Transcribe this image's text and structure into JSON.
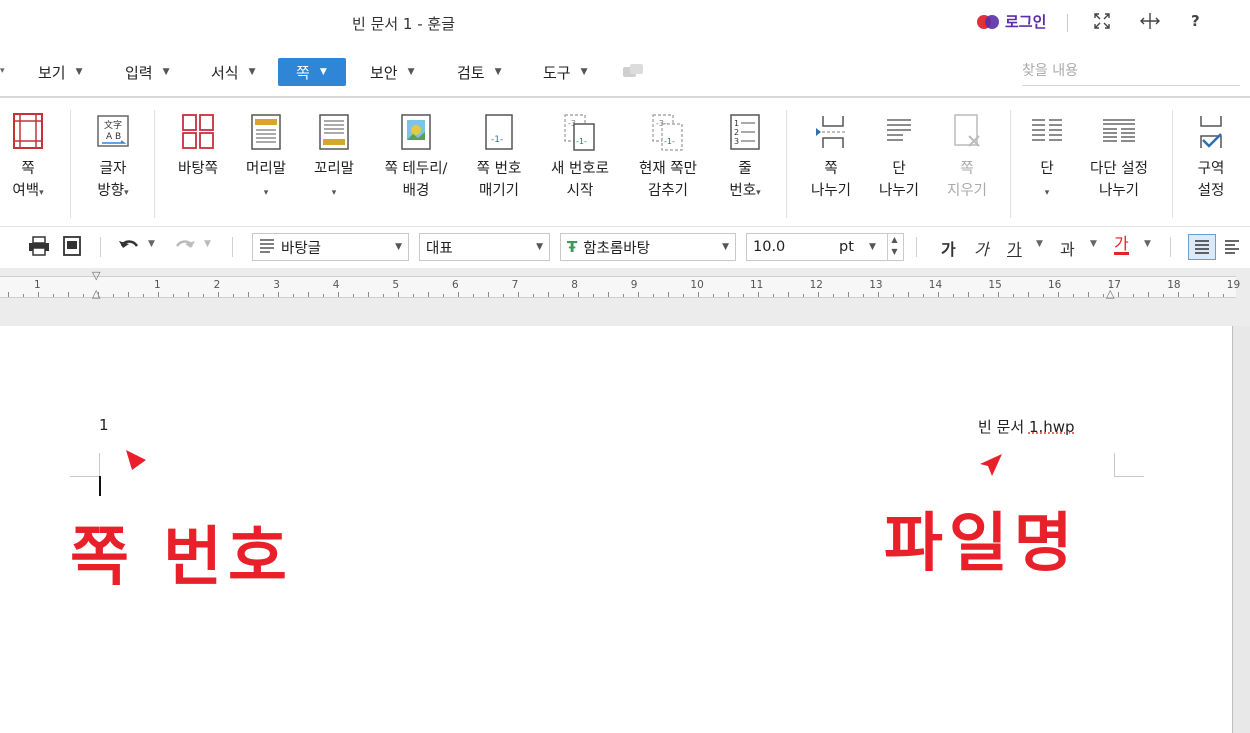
{
  "window": {
    "title": "빈 문서 1 - 훈글",
    "login_label": "로그인",
    "icons": [
      "fullscreen-icon",
      "resize-icon",
      "help-icon"
    ],
    "help_glyph": "?"
  },
  "menu": {
    "items": [
      {
        "label": "보기"
      },
      {
        "label": "입력"
      },
      {
        "label": "서식"
      },
      {
        "label": "쪽",
        "active": true
      },
      {
        "label": "보안"
      },
      {
        "label": "검토"
      },
      {
        "label": "도구"
      }
    ],
    "search_placeholder": "찾을 내용"
  },
  "ribbon": {
    "page_margin": {
      "line1": "쪽",
      "line2": "여백"
    },
    "text_direction": {
      "line1": "글자",
      "line2": "방향"
    },
    "background_page": {
      "line1": "바탕쪽"
    },
    "header": {
      "line1": "머리말"
    },
    "footer": {
      "line1": "꼬리말"
    },
    "page_border": {
      "line1": "쪽 테두리/",
      "line2": "배경"
    },
    "page_number": {
      "line1": "쪽 번호",
      "line2": "매기기"
    },
    "new_number": {
      "line1": "새 번호로",
      "line2": "시작"
    },
    "hide_current": {
      "line1": "현재 쪽만",
      "line2": "감추기"
    },
    "line_number": {
      "line1": "줄",
      "line2": "번호"
    },
    "page_break": {
      "line1": "쪽",
      "line2": "나누기"
    },
    "column_break": {
      "line1": "단",
      "line2": "나누기"
    },
    "delete_page": {
      "line1": "쪽",
      "line2": "지우기"
    },
    "columns": {
      "line1": "단"
    },
    "multi_column": {
      "line1": "다단 설정",
      "line2": "나누기"
    },
    "section": {
      "line1": "구역",
      "line2": "설정"
    }
  },
  "format_bar": {
    "style": "바탕글",
    "style_lang": "대표",
    "font": "함초롬바탕",
    "size": "10.0",
    "unit": "pt",
    "bold_glyph": "가",
    "italic_glyph": "가",
    "underline_glyph": "가",
    "strike_glyph": "과",
    "color_glyph": "가",
    "accent_color": "#2f86d6",
    "text_color": "#e8202a"
  },
  "ruler": {
    "labels": [
      "1",
      "1",
      "2",
      "3",
      "4",
      "5",
      "6",
      "7",
      "8",
      "9",
      "10",
      "11",
      "12",
      "13",
      "14",
      "15",
      "16",
      "17",
      "18",
      "19"
    ]
  },
  "document": {
    "page_number_text": "1",
    "filename_prefix": "빈 문서 ",
    "filename_underlined": "1.hwp",
    "annotation_left": "쪽 번호",
    "annotation_right": "파일명",
    "annotation_color": "#e8202a"
  }
}
